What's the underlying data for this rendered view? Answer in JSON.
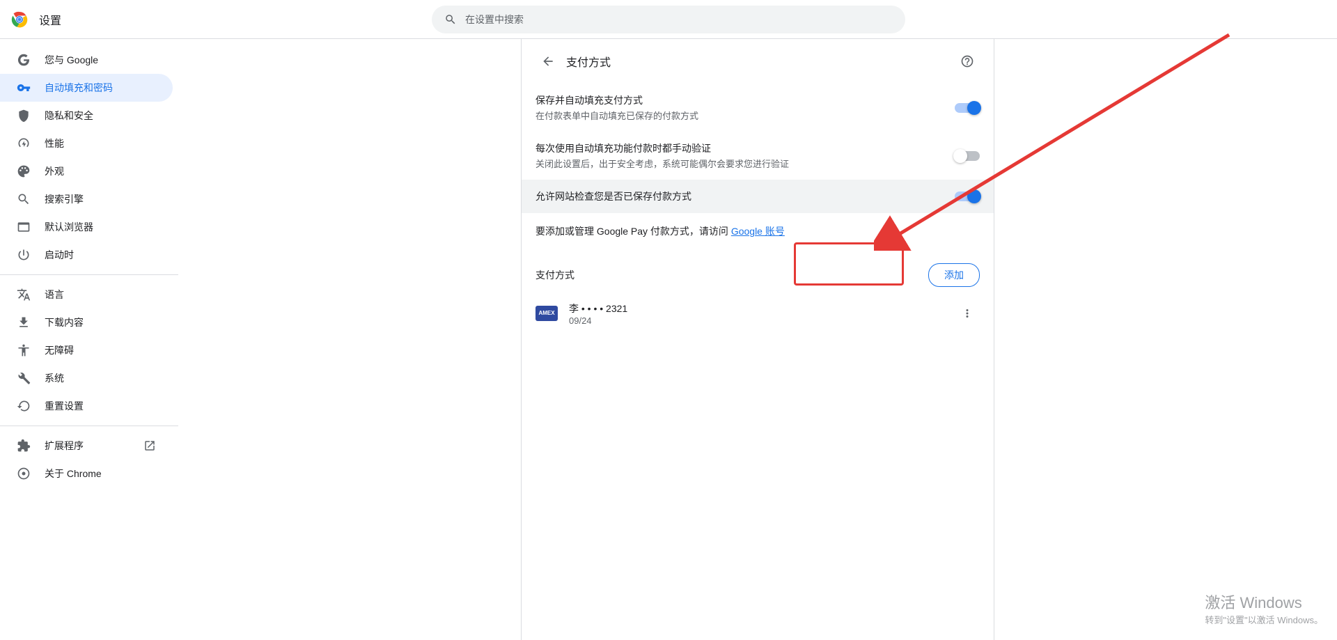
{
  "header": {
    "title": "设置",
    "search_placeholder": "在设置中搜索"
  },
  "sidebar": {
    "items": [
      {
        "label": "您与 Google"
      },
      {
        "label": "自动填充和密码"
      },
      {
        "label": "隐私和安全"
      },
      {
        "label": "性能"
      },
      {
        "label": "外观"
      },
      {
        "label": "搜索引擎"
      },
      {
        "label": "默认浏览器"
      },
      {
        "label": "启动时"
      }
    ],
    "items2": [
      {
        "label": "语言"
      },
      {
        "label": "下载内容"
      },
      {
        "label": "无障碍"
      },
      {
        "label": "系统"
      },
      {
        "label": "重置设置"
      }
    ],
    "items3": [
      {
        "label": "扩展程序"
      },
      {
        "label": "关于 Chrome"
      }
    ]
  },
  "page": {
    "title": "支付方式",
    "setting1": {
      "title": "保存并自动填充支付方式",
      "sub": "在付款表单中自动填充已保存的付款方式"
    },
    "setting2": {
      "title": "每次使用自动填充功能付款时都手动验证",
      "sub": "关闭此设置后，出于安全考虑，系统可能偶尔会要求您进行验证"
    },
    "setting3": {
      "title": "允许网站检查您是否已保存付款方式"
    },
    "gpay_text": "要添加或管理 Google Pay 付款方式，请访问 ",
    "gpay_link": "Google 账号",
    "pay_section": "支付方式",
    "add_btn": "添加",
    "card": {
      "name": "李 • • • • 2321",
      "exp": "09/24"
    }
  },
  "watermark": {
    "line1": "激活 Windows",
    "line2": "转到\"设置\"以激活 Windows。"
  }
}
